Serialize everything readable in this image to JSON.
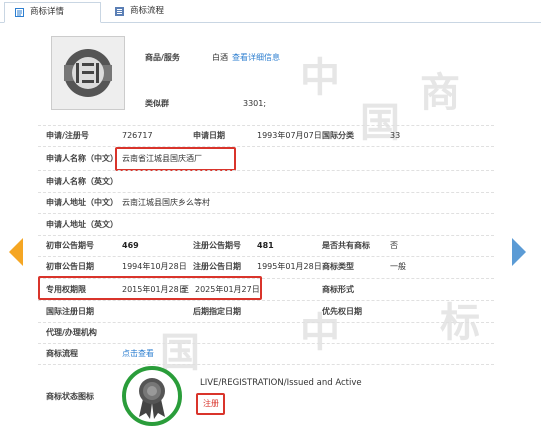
{
  "tabs": [
    {
      "label": "商标详情",
      "icon": "document-icon"
    },
    {
      "label": "商标流程",
      "icon": "list-icon"
    }
  ],
  "goods_services": {
    "label": "商品/服务",
    "value": "白酒",
    "link": "查看详细信息"
  },
  "class_group": {
    "label": "类似群",
    "value": "3301;"
  },
  "fields": {
    "reg_no_label": "申请/注册号",
    "reg_no": "726717",
    "app_date_label": "申请日期",
    "app_date": "1993年07月07日",
    "intl_class_label": "国际分类",
    "intl_class": "33",
    "applicant_cn_label": "申请人名称（中文）",
    "applicant_cn": "云南省江城县国庆酒厂",
    "applicant_en_label": "申请人名称（英文）",
    "address_cn_label": "申请人地址（中文）",
    "address_cn": "云南江城县国庆乡么等村",
    "address_en_label": "申请人地址（英文）",
    "prelim_issue_label": "初审公告期号",
    "prelim_issue": "469",
    "reg_issue_label": "注册公告期号",
    "reg_issue": "481",
    "shared_label": "是否共有商标",
    "shared": "否",
    "prelim_date_label": "初审公告日期",
    "prelim_date": "1994年10月28日",
    "reg_date_label": "注册公告日期",
    "reg_date": "1995年01月28日",
    "mark_type_label": "商标类型",
    "mark_type": "一般",
    "exclusive_label": "专用权期限",
    "exclusive_from": "2015年01月28日",
    "exclusive_sep": "至",
    "exclusive_to": "2025年01月27日",
    "mark_form_label": "商标形式",
    "intl_reg_date_label": "国际注册日期",
    "later_date_label": "后期指定日期",
    "priority_label": "优先权日期",
    "agent_label": "代理/办理机构",
    "process_label": "商标流程",
    "process_link": "点击查看",
    "status_label": "商标状态图标",
    "status_text": "LIVE/REGISTRATION/Issued and Active",
    "status_badge": "注册"
  },
  "colors": {
    "accent": "#2e7fd0",
    "highlight": "#d9342b",
    "nav_left": "#f5a623",
    "nav_right": "#5b9bd5",
    "status_ring": "#2a9d3a"
  },
  "watermark": [
    "中",
    "国",
    "商",
    "标"
  ]
}
